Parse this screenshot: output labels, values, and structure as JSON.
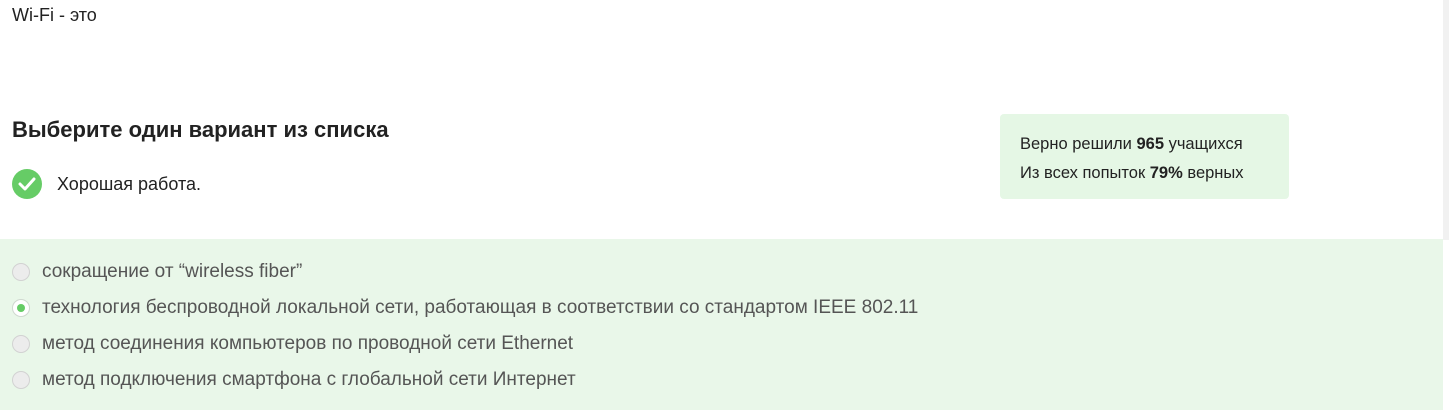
{
  "question": {
    "text": "Wi-Fi - это"
  },
  "instruction": "Выберите один вариант из списка",
  "feedback": {
    "icon": "check-icon",
    "text": "Хорошая работа.",
    "color": "#66cc66"
  },
  "stats": {
    "line1_prefix": "Верно решили ",
    "solved_count": "965",
    "line1_suffix": " учащихся",
    "line2_prefix": "Из всех попыток ",
    "percent": "79%",
    "line2_suffix": " верных"
  },
  "options": [
    {
      "label": "сокращение от “wireless fiber”",
      "selected": false
    },
    {
      "label": "технология беспроводной локальной сети, работающая в соответствии со стандартом IEEE 802.11",
      "selected": true
    },
    {
      "label": "метод соединения компьютеров по проводной сети Ethernet",
      "selected": false
    },
    {
      "label": "метод подключения смартфона с глобальной сети Интернет",
      "selected": false
    }
  ],
  "colors": {
    "accent": "#66cc66",
    "panel_bg": "#e9f7e9",
    "stats_bg": "#e5f7e5"
  }
}
